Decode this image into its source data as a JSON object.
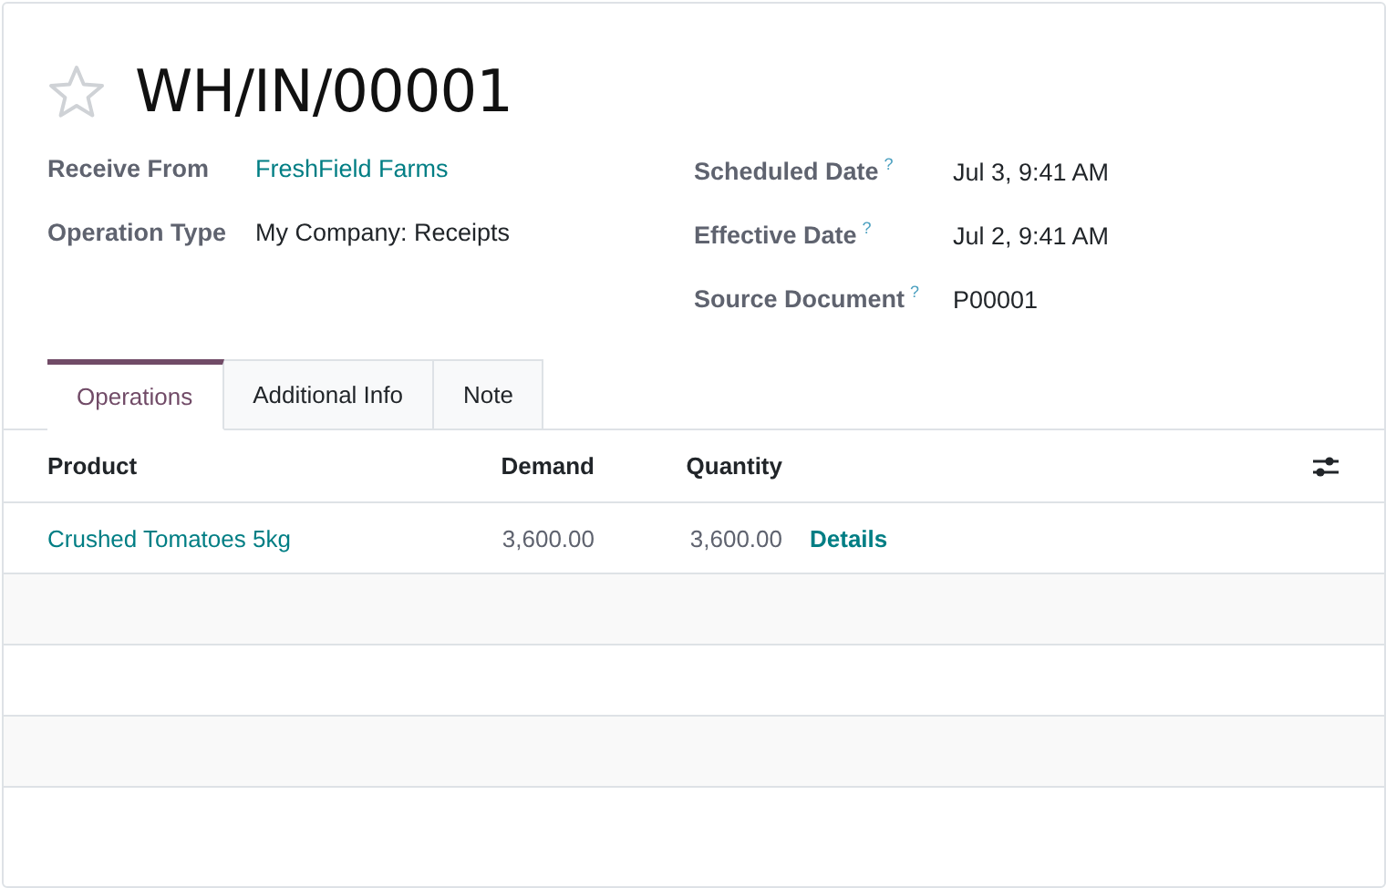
{
  "record": {
    "title": "WH/IN/00001",
    "favorite": false
  },
  "left_fields": [
    {
      "label": "Receive From",
      "value": "FreshField Farms",
      "kind": "link"
    },
    {
      "label": "Operation Type",
      "value": "My Company: Receipts",
      "kind": "text"
    }
  ],
  "right_fields": [
    {
      "label": "Scheduled Date",
      "help": "?",
      "value": "Jul 3, 9:41 AM",
      "kind": "text"
    },
    {
      "label": "Effective Date",
      "help": "?",
      "value": "Jul 2, 9:41 AM",
      "kind": "text"
    },
    {
      "label": "Source Document",
      "help": "?",
      "value": "P00001",
      "kind": "text"
    }
  ],
  "tabs": [
    {
      "label": "Operations",
      "selected": true
    },
    {
      "label": "Additional Info",
      "selected": false
    },
    {
      "label": "Note",
      "selected": false
    }
  ],
  "table": {
    "columns": [
      "Product",
      "Demand",
      "Quantity"
    ],
    "rows": [
      {
        "product": "Crushed Tomatoes 5kg",
        "demand": "3,600.00",
        "quantity": "3,600.00",
        "action": "Details"
      }
    ]
  }
}
